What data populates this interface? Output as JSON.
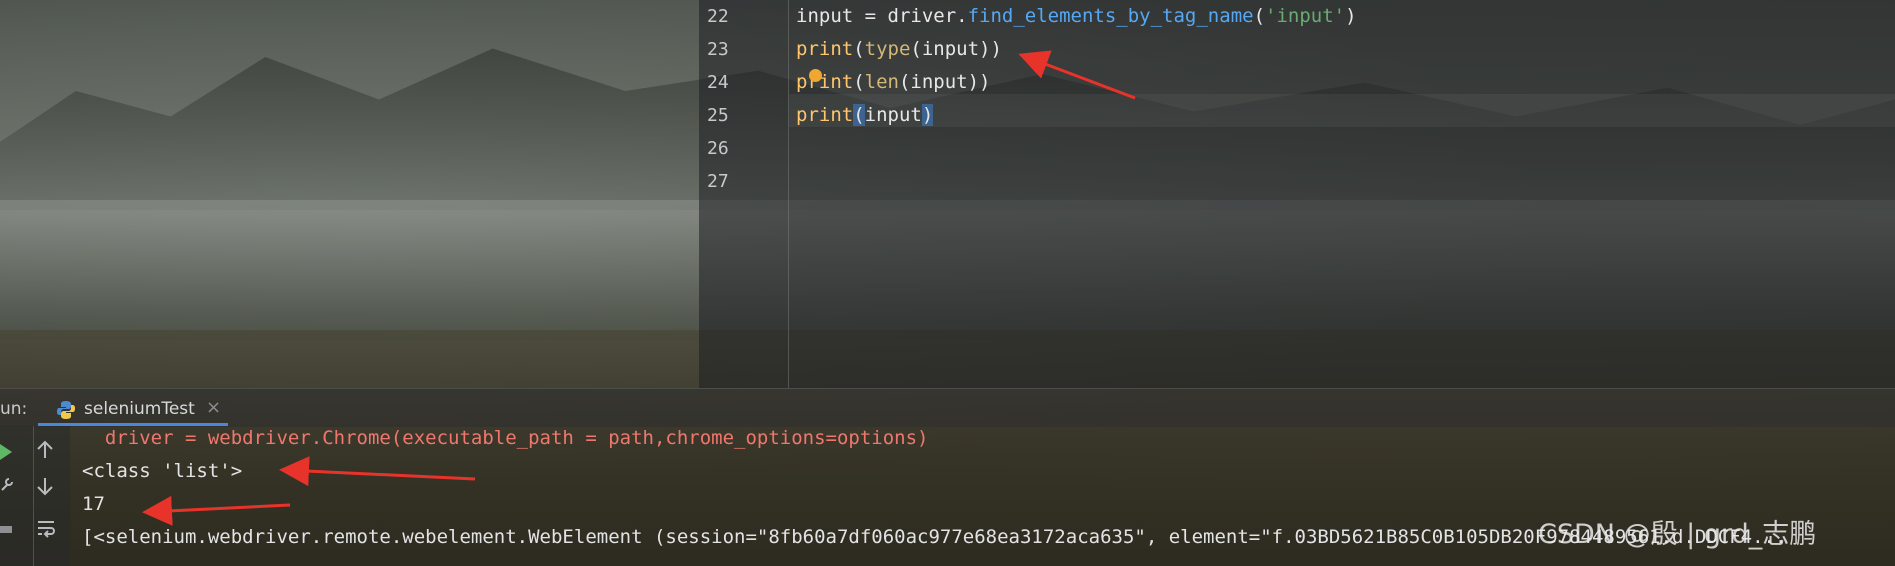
{
  "editor": {
    "lines": [
      {
        "number": "22",
        "parts": [
          [
            "plain",
            "input = driver."
          ],
          [
            "method",
            "find_elements_by_tag_name"
          ],
          [
            "plain",
            "("
          ],
          [
            "str",
            "'input'"
          ],
          [
            "plain",
            ")"
          ]
        ]
      },
      {
        "number": "23",
        "parts": [
          [
            "fn",
            "print"
          ],
          [
            "plain",
            "("
          ],
          [
            "builtin",
            "type"
          ],
          [
            "plain",
            "(input))"
          ]
        ]
      },
      {
        "number": "24",
        "parts": [
          [
            "fn",
            "print"
          ],
          [
            "plain",
            "("
          ],
          [
            "builtin",
            "len"
          ],
          [
            "plain",
            "(input))"
          ]
        ]
      },
      {
        "number": "25",
        "parts": [
          [
            "fn",
            "print"
          ],
          [
            "hl",
            "("
          ],
          [
            "plain",
            "input"
          ],
          [
            "hl",
            ")"
          ]
        ]
      },
      {
        "number": "26",
        "parts": []
      },
      {
        "number": "27",
        "parts": []
      }
    ]
  },
  "run_panel": {
    "label": "un:",
    "tab_name": "seleniumTest",
    "tab_close": "×",
    "icons": {
      "tab": "python-icon",
      "run": "run-icon",
      "up": "arrow-up-icon",
      "down": "arrow-down-icon",
      "wrap": "soft-wrap-icon",
      "settings": "wrench-icon",
      "print": "print-icon"
    }
  },
  "console": {
    "lines": [
      {
        "text": "  driver = webdriver.Chrome(executable_path = path,chrome_options=options)",
        "kind": "error"
      },
      {
        "text": "<class 'list'>",
        "kind": "output"
      },
      {
        "text": "17",
        "kind": "output"
      },
      {
        "text": "[<selenium.webdriver.remote.webelement.WebElement (session=\"8fb60a7df060ac977e68ea3172aca635\", element=\"f.03BD5621B85C0B105DB20F9784489561.d.DDCF4...",
        "kind": "output"
      }
    ]
  },
  "watermark": "CSDN @殷 | grd_志鹏",
  "colors": {
    "accent": "#4a87d8",
    "annotation_arrow": "#e8332b"
  }
}
